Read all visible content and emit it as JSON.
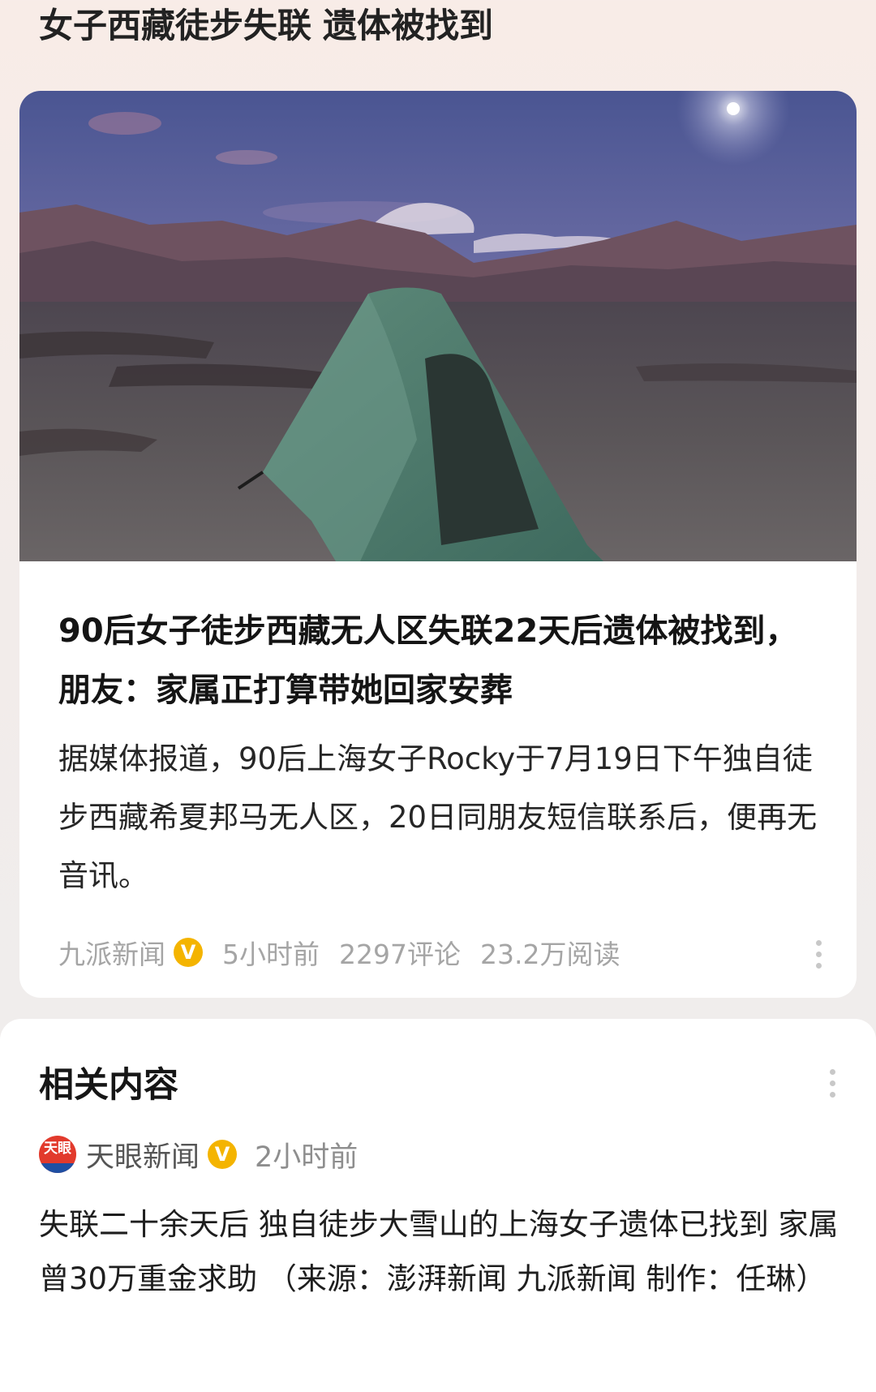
{
  "topic": {
    "title_part1": "女子西藏徒步失联",
    "title_part2": "遗体被找到"
  },
  "article": {
    "image_alt": "campsite tent on Tibetan highland at dusk",
    "headline": "90后女子徒步西藏无人区失联22天后遗体被找到，朋友：家属正打算带她回家安葬",
    "summary": "据媒体报道，90后上海女子Rocky于7月19日下午独自徒步西藏希夏邦马无人区，20日同朋友短信联系后，便再无音讯。",
    "source": "九派新闻",
    "verified_badge": "V",
    "time": "5小时前",
    "comments": "2297评论",
    "reads": "23.2万阅读",
    "more_icon": "more-vertical-icon"
  },
  "related": {
    "title": "相关内容",
    "more_icon": "more-vertical-icon",
    "item": {
      "logo_text": "天眼",
      "source": "天眼新闻",
      "verified_badge": "V",
      "time": "2小时前",
      "text": "失联二十余天后 独自徒步大雪山的上海女子遗体已找到 家属曾30万重金求助 （来源：澎湃新闻 九派新闻 制作：任琳）"
    }
  },
  "colors": {
    "badge": "#f4b400",
    "meta_text": "#a5a5a5",
    "logo_red": "#e23a2c"
  }
}
